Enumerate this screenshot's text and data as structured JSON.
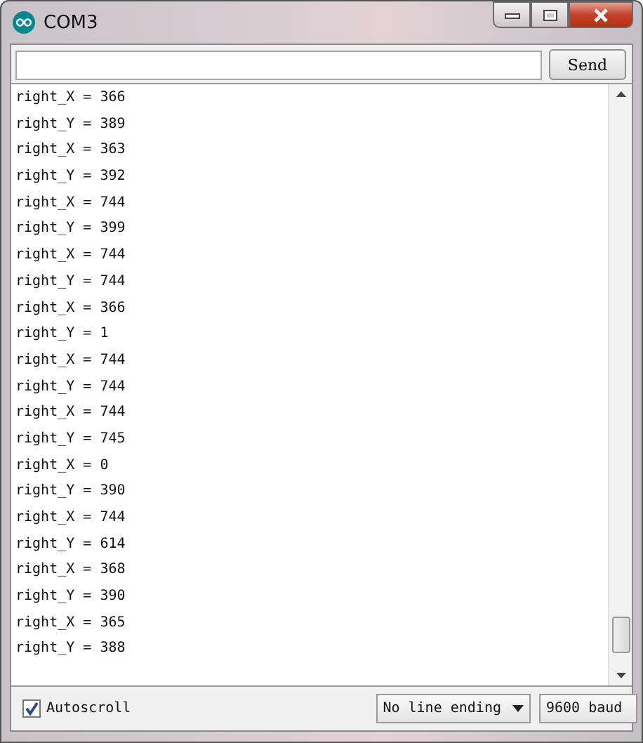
{
  "window": {
    "title": "COM3"
  },
  "send_button": {
    "label": "Send"
  },
  "output_lines": [
    "right_X = 366",
    "right_Y = 389",
    "right_X = 363",
    "right_Y = 392",
    "right_X = 744",
    "right_Y = 399",
    "right_X = 744",
    "right_Y = 744",
    "right_X = 366",
    "right_Y = 1",
    "right_X = 744",
    "right_Y = 744",
    "right_X = 744",
    "right_Y = 745",
    "right_X = 0",
    "right_Y = 390",
    "right_X = 744",
    "right_Y = 614",
    "right_X = 368",
    "right_Y = 390",
    "right_X = 365",
    "right_Y = 388"
  ],
  "autoscroll": {
    "label": "Autoscroll",
    "checked": true
  },
  "line_ending": {
    "value": "No line ending"
  },
  "baud": {
    "value": "9600 baud"
  }
}
